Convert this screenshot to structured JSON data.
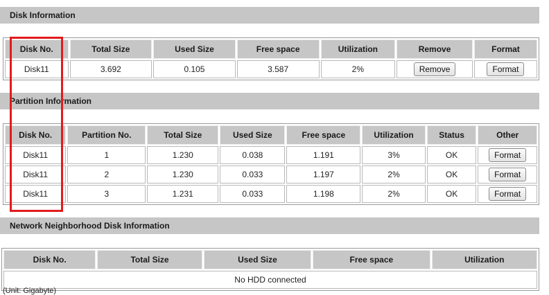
{
  "disk_info": {
    "title": "Disk Information",
    "headers": [
      "Disk No.",
      "Total Size",
      "Used Size",
      "Free space",
      "Utilization",
      "Remove",
      "Format"
    ],
    "rows": [
      {
        "disk_no": "Disk11",
        "total": "3.692",
        "used": "0.105",
        "free": "3.587",
        "util": "2%",
        "remove_label": "Remove",
        "format_label": "Format"
      }
    ]
  },
  "partition_info": {
    "title": "Partition Information",
    "headers": [
      "Disk No.",
      "Partition No.",
      "Total Size",
      "Used Size",
      "Free space",
      "Utilization",
      "Status",
      "Other"
    ],
    "rows": [
      {
        "disk_no": "Disk11",
        "part_no": "1",
        "total": "1.230",
        "used": "0.038",
        "free": "1.191",
        "util": "3%",
        "status": "OK",
        "action_label": "Format"
      },
      {
        "disk_no": "Disk11",
        "part_no": "2",
        "total": "1.230",
        "used": "0.033",
        "free": "1.197",
        "util": "2%",
        "status": "OK",
        "action_label": "Format"
      },
      {
        "disk_no": "Disk11",
        "part_no": "3",
        "total": "1.231",
        "used": "0.033",
        "free": "1.198",
        "util": "2%",
        "status": "OK",
        "action_label": "Format"
      }
    ]
  },
  "network_info": {
    "title": "Network Neighborhood Disk Information",
    "headers": [
      "Disk No.",
      "Total Size",
      "Used Size",
      "Free space",
      "Utilization"
    ],
    "empty_message": "No HDD connected"
  },
  "unit_note": "(Unit: Gigabyte)",
  "colors": {
    "highlight": "#e21b1b",
    "header_bg": "#c6c6c6",
    "empty_row_bg": "#d8d8e0"
  }
}
